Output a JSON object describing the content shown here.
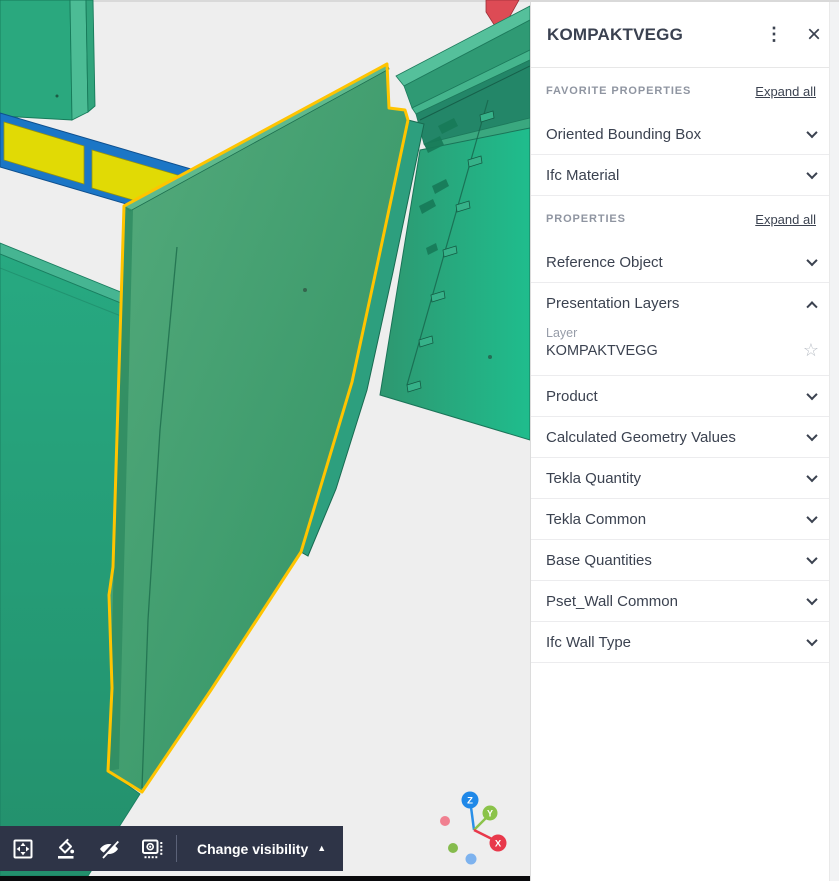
{
  "panel": {
    "title": "KOMPAKTVEGG",
    "icons": {
      "kebab": "⋮",
      "close": "×",
      "star": "☆"
    },
    "groups": [
      {
        "label": "FAVORITE PROPERTIES",
        "action": "Expand all",
        "sections": [
          {
            "label": "Oriented Bounding Box",
            "expanded": false
          },
          {
            "label": "Ifc Material",
            "expanded": false
          }
        ]
      },
      {
        "label": "PROPERTIES",
        "action": "Expand all",
        "sections": [
          {
            "label": "Reference Object",
            "expanded": false
          },
          {
            "label": "Presentation Layers",
            "expanded": true,
            "fields": [
              {
                "label": "Layer",
                "value": "KOMPAKTVEGG"
              }
            ]
          },
          {
            "label": "Product",
            "expanded": false
          },
          {
            "label": "Calculated Geometry Values",
            "expanded": false
          },
          {
            "label": "Tekla Quantity",
            "expanded": false
          },
          {
            "label": "Tekla Common",
            "expanded": false
          },
          {
            "label": "Base Quantities",
            "expanded": false
          },
          {
            "label": "Pset_Wall Common",
            "expanded": false
          },
          {
            "label": "Ifc Wall Type",
            "expanded": false
          }
        ]
      }
    ]
  },
  "toolbar": {
    "buttons": [
      {
        "name": "fit-to-view"
      },
      {
        "name": "paint-fill-visibility"
      },
      {
        "name": "hide-objects"
      },
      {
        "name": "section-box"
      }
    ],
    "change_visibility": {
      "label": "Change visibility",
      "arrow": "▲"
    }
  },
  "viewport": {
    "gizmo": {
      "axes": [
        {
          "label": "Z",
          "color": "#1F88E8"
        },
        {
          "label": "Y",
          "color": "#8BC34A"
        },
        {
          "label": "X",
          "color": "#E8394B"
        }
      ]
    },
    "selection": {
      "layer": "KOMPAKTVEGG",
      "outline_color": "#FFC400"
    },
    "colors": {
      "background": "#EEEEEE",
      "selected_wall_green": "#3C9E6B",
      "wall_teal": "#22A481",
      "rail_yellow": "#E1DA05",
      "rail_blue": "#1B76C6",
      "accent_red": "#DD4B55",
      "toolbar_bg": "#2E3447"
    }
  }
}
